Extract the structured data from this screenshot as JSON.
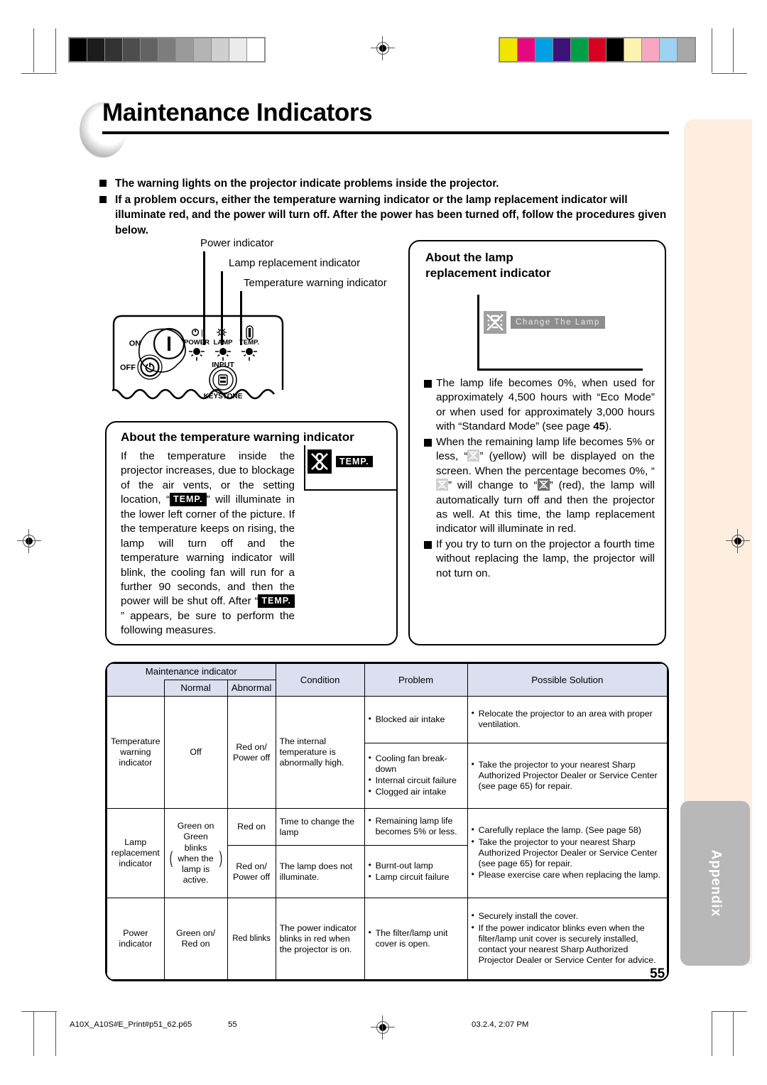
{
  "page": {
    "title": "Maintenance Indicators",
    "number": "55",
    "appendix_tab": "Appendix"
  },
  "intro": {
    "bullets": [
      "The warning lights on the projector indicate problems inside the projector.",
      "If a problem occurs, either the temperature warning indicator or the lamp replacement indicator will illuminate red, and the power will turn off. After the power has been turned off, follow the procedures given below."
    ]
  },
  "diagram": {
    "callouts": [
      "Power indicator",
      "Lamp replacement indicator",
      "Temperature warning indicator"
    ],
    "panel_labels": {
      "on": "ON",
      "off": "OFF",
      "power": "POWER",
      "lamp": "LAMP",
      "temp": "TEMP",
      "input": "INPUT",
      "keystone": "KEYSTONE"
    }
  },
  "temp_box": {
    "heading": "About the temperature warning indicator",
    "osd_badge": "TEMP.",
    "text_part1": "If the temperature inside the projector increases, due to blockage of the air vents, or the setting location, “",
    "badge1": "TEMP.",
    "text_part2": "” will illuminate in the lower left corner of the picture. If the temperature keeps on rising, the lamp will turn off and the temperature warning indicator will blink, the cooling fan will run for a further 90 seconds, and then the power will be shut off. After “",
    "badge2": "TEMP.",
    "text_part3": "” appears, be sure to perform the following measures."
  },
  "lamp_box": {
    "heading_line1": "About the lamp",
    "heading_line2": "replacement indicator",
    "osd_text": "Change The Lamp",
    "bullets": [
      "The lamp life becomes 0%, when used for approximately 4,500 hours with “Eco Mode” or when used for approximately 3,000 hours with “Standard Mode” (see page 45).",
      "When the remaining lamp life becomes 5% or less, “” (yellow) will be displayed on the screen. When the percentage becomes 0%, “” will change to “” (red), the lamp will automatically turn off and then the projector as well. At this time, the lamp replacement indicator will illuminate in red.",
      "If you try to turn on the projector a fourth time without replacing the lamp, the projector will not turn on."
    ],
    "bullet1_pre": "The lamp life becomes 0%, when used for approximately 4,500 hours with “Eco Mode” or when used for approximately 3,000 hours with “Standard Mode” (see page ",
    "bullet1_page": "45",
    "bullet1_post": ").",
    "bullet2_a": "When the remaining lamp life becomes 5% or less, “",
    "bullet2_b": "” (yellow) will be displayed on the screen. When the percentage becomes 0%, “",
    "bullet2_c": "” will change to “",
    "bullet2_d": "” (red), the lamp will automatically turn off and then the projector as well. At this time, the lamp replacement indicator will illuminate in red.",
    "bullet3": "If you try to turn on the projector a fourth time without replacing the lamp, the projector will not turn on."
  },
  "table": {
    "headers": {
      "group": "Maintenance indicator",
      "normal": "Normal",
      "abnormal": "Abnormal",
      "condition": "Condition",
      "problem": "Problem",
      "solution": "Possible Solution"
    },
    "rows": [
      {
        "indicator": "Temperature warning indicator",
        "normal": "Off",
        "abnormal": "Red on/ Power off",
        "condition": "The internal temperature is abnormally high.",
        "subrows": [
          {
            "problems": [
              "Blocked air intake"
            ],
            "solutions": [
              "Relocate the projector to an area with proper ventilation."
            ]
          },
          {
            "problems": [
              "Cooling fan break-down",
              "Internal circuit failure",
              "Clogged air intake"
            ],
            "solutions": [
              "Take the projector to your nearest Sharp Authorized Projector Dealer or Service Center (see page 65) for repair."
            ]
          }
        ]
      },
      {
        "indicator": "Lamp replacement indicator",
        "normal_line1": "Green on",
        "normal_paren": "Green blinks when the lamp is active.",
        "subrows": [
          {
            "abnormal": "Red on",
            "condition": "Time to change the lamp",
            "problems": [
              "Remaining lamp life becomes 5% or less."
            ]
          },
          {
            "abnormal": "Red on/ Power off",
            "condition": "The lamp does not illuminate.",
            "problems": [
              "Burnt-out lamp",
              "Lamp circuit failure"
            ]
          }
        ],
        "solutions": [
          "Carefully replace the lamp. (See page 58)",
          "Take the projector to your nearest Sharp Authorized Projector Dealer or Service Center (see page 65) for repair.",
          "Please exercise care when replacing the lamp."
        ]
      },
      {
        "indicator": "Power indicator",
        "normal": "Green on/ Red on",
        "abnormal": "Red blinks",
        "condition": "The power indicator blinks in red when the projector is on.",
        "problems": [
          "The filter/lamp unit cover is open."
        ],
        "solutions": [
          "Securely install the cover.",
          "If the power indicator blinks even when the filter/lamp unit cover is securely installed, contact your nearest Sharp Authorized Projector Dealer or Service Center for advice."
        ]
      }
    ]
  },
  "footer": {
    "filename": "A10X_A10S#E_Print#p51_62.p65",
    "page": "55",
    "timestamp": "03.2.4, 2:07 PM"
  },
  "colors": {
    "table_header": "#dcdff0",
    "peach_band": "#fdeedf",
    "appendix_tab": "#b8b8b8",
    "gray_bar": [
      "#000000",
      "#1c1c1c",
      "#333333",
      "#4d4d4d",
      "#636363",
      "#7d7d7d",
      "#9a9a9a",
      "#b4b4b4",
      "#cfcfcf",
      "#ebebeb",
      "#ffffff"
    ],
    "color_bar": [
      "#f2e500",
      "#e5097f",
      "#00a0e4",
      "#3d1278",
      "#00a04a",
      "#d80021",
      "#000000",
      "#fbf4b0",
      "#f7a8c0",
      "#9ed2f2",
      "#a8a8a8"
    ]
  }
}
